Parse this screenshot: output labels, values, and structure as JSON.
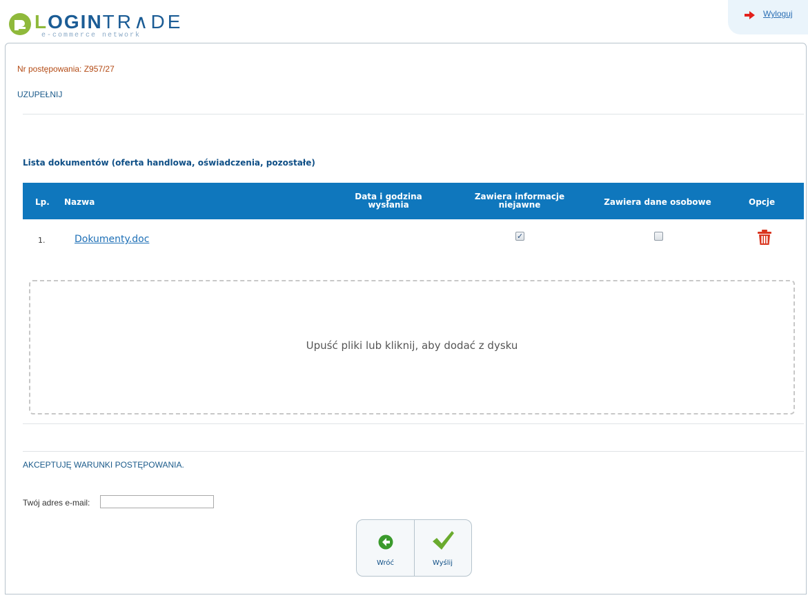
{
  "header": {
    "logo": {
      "main": "LOGINTRADE",
      "subtitle": "e-commerce network"
    },
    "logout_label": "Wyloguj"
  },
  "procedure": {
    "number_text": "Nr postępowania: Z957/27",
    "section_title": "UZUPEŁNIJ"
  },
  "documents": {
    "title": "Lista dokumentów (oferta handlowa, oświadczenia, pozostałe)",
    "columns": {
      "lp": "Lp.",
      "name": "Nazwa",
      "sent_date_line1": "Data i godzina",
      "sent_date_line2": "wysłania",
      "classified_line1": "Zawiera informacje",
      "classified_line2": "niejawne",
      "personal": "Zawiera dane osobowe",
      "options": "Opcje"
    },
    "rows": [
      {
        "number": "1.",
        "name": "Dokumenty.doc",
        "sent_date": "",
        "contains_classified": true,
        "contains_personal": false
      }
    ],
    "dropzone_text": "Upuść pliki lub kliknij, aby dodać z dysku"
  },
  "footer": {
    "accept_text": "AKCEPTUJĘ WARUNKI POSTĘPOWANIA.",
    "email_label": "Twój adres e-mail:",
    "email_value": "",
    "back_label": "Wróć",
    "send_label": "Wyślij"
  },
  "colors": {
    "table_header": "#0f77bd",
    "link": "#1d6fb6",
    "procedure_number": "#b34a14",
    "delete_icon": "#d9341e",
    "back_icon": "#3a9a2c",
    "send_icon": "#6aab2e"
  },
  "icons": {
    "logout": "red-arrow-right-icon",
    "delete": "trash-icon",
    "back": "arrow-left-circle-icon",
    "send": "checkmark-icon"
  }
}
